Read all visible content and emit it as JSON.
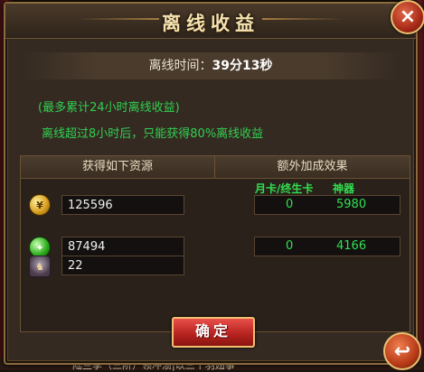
{
  "dialog": {
    "title": "离线收益",
    "close_icon": "×",
    "back_icon": "↩"
  },
  "offline_time": {
    "label": "离线时间：",
    "value": "39分13秒"
  },
  "notes": {
    "line1": "(最多累计24小时离线收益)",
    "line2": "离线超过8小时后，只能获得80%离线收益"
  },
  "table": {
    "header_left": "获得如下资源",
    "header_right": "额外加成效果",
    "sub_label_card": "月卡/终生卡",
    "sub_label_artifact": "神器"
  },
  "resources": [
    {
      "icon": "gold-coin-icon",
      "value": "125596",
      "bonus_card": "0",
      "bonus_artifact": "5980"
    },
    {
      "icon": "green-exp-icon",
      "value": "87494",
      "bonus_card": "0",
      "bonus_artifact": "4166"
    },
    {
      "icon": "figure-item-icon",
      "value": "22"
    }
  ],
  "buttons": {
    "confirm": "确定"
  },
  "background": {
    "bottom_text": "陆兰季（三阶）领冲溃|以三个羽翅事"
  },
  "colors": {
    "accent_green": "#30e050",
    "title_gold": "#f4e3b0",
    "button_red": "#b82420"
  }
}
